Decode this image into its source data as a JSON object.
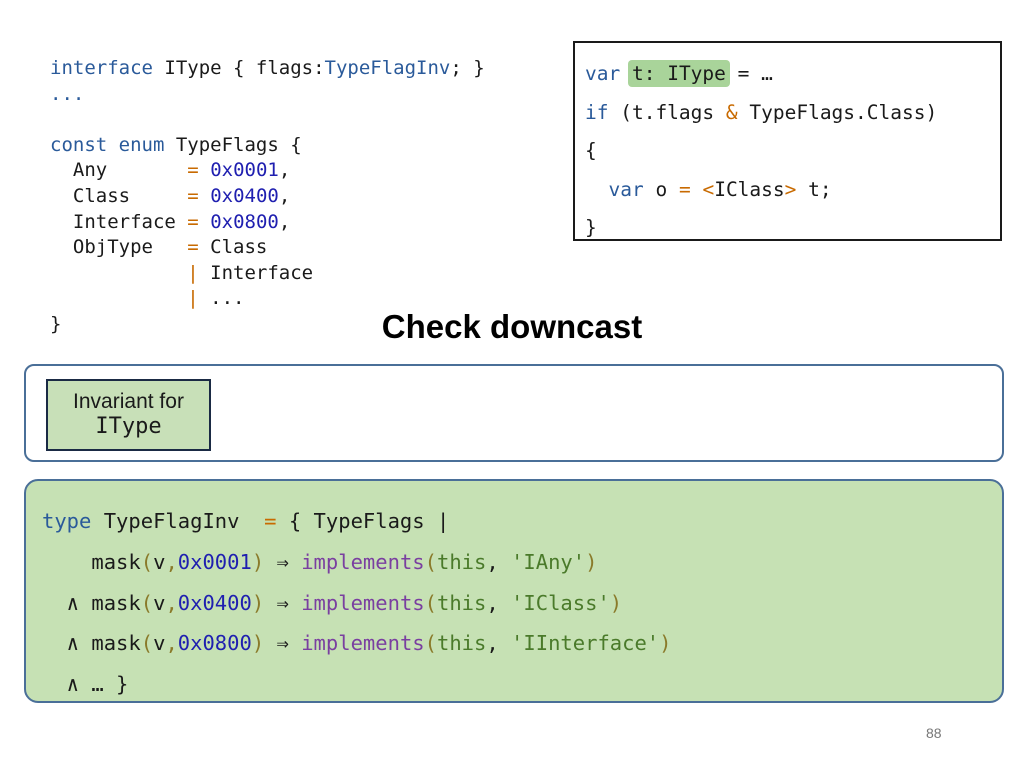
{
  "left_code": {
    "l1_kw": "interface",
    "l1_name": " IType { flags:",
    "l1_type": "TypeFlagInv",
    "l1_end": "; }",
    "l2": "...",
    "l4_kw": "const enum",
    "l4_rest": " TypeFlags {",
    "any_name": "  Any       ",
    "any_op": "=",
    "any_val": "0x0001",
    "any_end": ",",
    "class_name": "  Class     ",
    "class_op": "=",
    "class_val": "0x0400",
    "class_end": ",",
    "iface_name": "  Interface ",
    "iface_op": "=",
    "iface_val": "0x0800",
    "iface_end": ",",
    "obj_name": "  ObjType   ",
    "obj_op": "=",
    "obj_val": " Class",
    "pipe1_pad": "            ",
    "pipe1_op": "|",
    "pipe1_val": " Interface",
    "pipe2_pad": "            ",
    "pipe2_op": "|",
    "pipe2_val": " ...",
    "close": "}"
  },
  "right_code": {
    "l1_kw": "var",
    "l1_hl": "t: IType",
    "l1_rest": " = …",
    "l2_kw": "if",
    "l2_a": " (t.flags ",
    "l2_op": "&",
    "l2_b": " TypeFlags.Class)",
    "l3": "{",
    "l4_kw": "var",
    "l4_a": " o ",
    "l4_op1": "=",
    "l4_sp": " ",
    "l4_op2": "<",
    "l4_cls": "IClass",
    "l4_op3": ">",
    "l4_end": " t;",
    "l5": "}"
  },
  "title": "Check downcast",
  "invariant": {
    "line1": "Invariant for",
    "line2": "IType"
  },
  "type_code": {
    "l1_kw": "type",
    "l1_name": " TypeFlagInv  ",
    "l1_op": "=",
    "l1_rest": " { TypeFlags |",
    "rows": [
      {
        "prefix": "    ",
        "fn": "mask",
        "p1": "(",
        "arg": "v",
        "comma": ",",
        "num": "0x0001",
        "p2": ")",
        "arrow": " ⇒ ",
        "impl": "implements",
        "p3": "(",
        "this": "this",
        "sep": ", ",
        "str": "'IAny'",
        "p4": ")"
      },
      {
        "prefix": "  ∧ ",
        "fn": "mask",
        "p1": "(",
        "arg": "v",
        "comma": ",",
        "num": "0x0400",
        "p2": ")",
        "arrow": " ⇒ ",
        "impl": "implements",
        "p3": "(",
        "this": "this",
        "sep": ", ",
        "str": "'IClass'",
        "p4": ")"
      },
      {
        "prefix": "  ∧ ",
        "fn": "mask",
        "p1": "(",
        "arg": "v",
        "comma": ",",
        "num": "0x0800",
        "p2": ")",
        "arrow": " ⇒ ",
        "impl": "implements",
        "p3": "(",
        "this": "this",
        "sep": ", ",
        "str": "'IInterface'",
        "p4": ")"
      }
    ],
    "last": "  ∧ … }"
  },
  "page_number": "88",
  "colors": {
    "keyword": "#2a5a9a",
    "number": "#1f1fb0",
    "operator": "#c86a00",
    "function": "#7a3fa0",
    "string": "#4a7a2a",
    "highlight": "#a9d49a",
    "panel_fill": "#c6e1b4",
    "panel_border": "#4a6f98"
  }
}
